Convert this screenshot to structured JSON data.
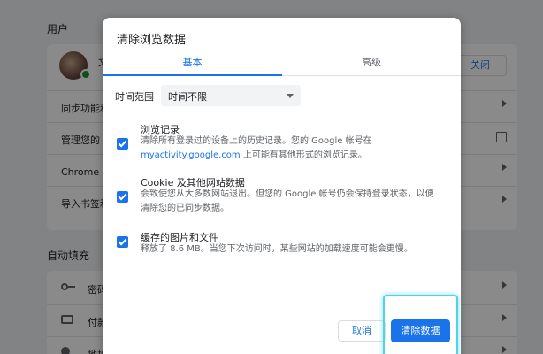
{
  "background": {
    "users_title": "用户",
    "autofill_title": "自动填充",
    "account_initial": "文",
    "close_label": "关闭",
    "rows_user": [
      "同步功能和",
      "管理您的 G",
      "Chrome 名",
      "导入书签和"
    ],
    "rows_autofill": [
      "密码",
      "付款",
      "地址"
    ]
  },
  "dialog": {
    "title": "清除浏览数据",
    "tabs": [
      "基本",
      "高级"
    ],
    "time_range_label": "时间范围",
    "time_range_value": "时间不限",
    "options": [
      {
        "title": "浏览记录",
        "desc1": "清除所有登录过的设备上的历史记录。您的 Google 帐号在",
        "link": "myactivity.google.com",
        "desc2": " 上可能有其他形式的浏览记录。"
      },
      {
        "title": "Cookie 及其他网站数据",
        "desc1": "会致使您从大多数网站退出。但您的 Google 帐号仍会保持登录状态，以便",
        "desc2": "清除您的已同步数据。"
      },
      {
        "title": "缓存的图片和文件",
        "desc1": "释放了 8.6 MB。当您下次访问时，某些网站的加载速度可能会更慢。"
      }
    ],
    "cancel_label": "取消",
    "clear_label": "清除数据"
  }
}
